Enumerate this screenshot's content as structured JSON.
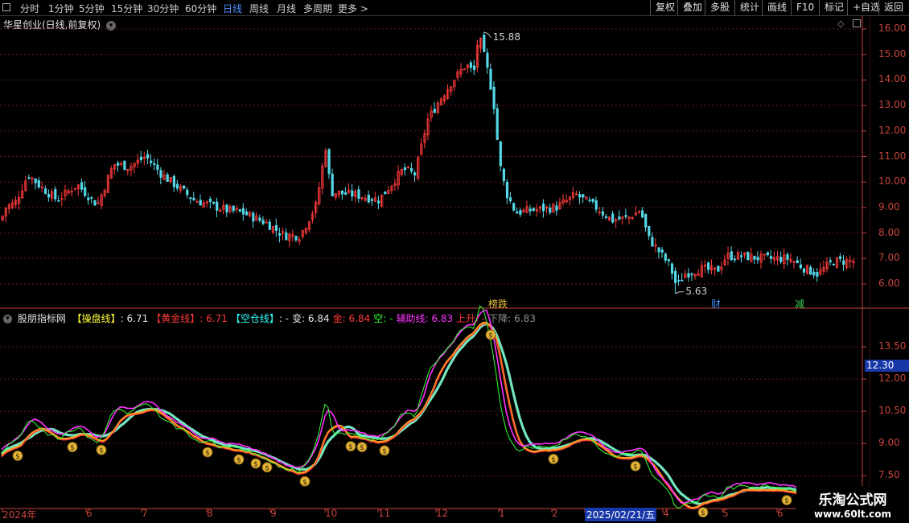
{
  "toolbar": {
    "periods": [
      "分时",
      "1分钟",
      "5分钟",
      "15分钟",
      "30分钟",
      "60分钟",
      "日线",
      "周线",
      "月线",
      "多周期",
      "更多 >"
    ],
    "active_period": "日线",
    "right_buttons": [
      "复权",
      "叠加",
      "多股",
      "统计",
      "画线",
      "F10",
      "标记",
      "+自选",
      "返回"
    ]
  },
  "main_panel": {
    "title": "华星创业(日线,前复权)",
    "y_ticks": [
      "16.00",
      "15.00",
      "14.00",
      "13.00",
      "12.00",
      "11.00",
      "10.00",
      "9.00",
      "8.00",
      "7.00",
      "6.00"
    ],
    "high_label": "15.88",
    "low_label": "5.63",
    "tags": [
      {
        "text": "榜跌",
        "color": "#e8c23a"
      },
      {
        "text": "财",
        "color": "#3a8cff"
      },
      {
        "text": "减",
        "color": "#32d052"
      }
    ]
  },
  "indicator_panel": {
    "name": "股朋指标网",
    "segments": [
      {
        "label": "【操盘线】",
        "value": ": 6.71",
        "label_color": "#ffff33",
        "value_color": "#e6e6e6"
      },
      {
        "label": "【黄金线】",
        "value": ": 6.71",
        "label_color": "#ff3a3a",
        "value_color": "#ff3a3a"
      },
      {
        "label": "【空仓线】",
        "value": ": -",
        "label_color": "#33ffff",
        "value_color": "#e6e6e6"
      },
      {
        "label": "变",
        "value": ": 6.84",
        "label_color": "#e6e6e6",
        "value_color": "#e6e6e6"
      },
      {
        "label": "金",
        "value": ": 6.84",
        "label_color": "#ff3a3a",
        "value_color": "#ff3a3a"
      },
      {
        "label": "空",
        "value": ": -",
        "label_color": "#33ff33",
        "value_color": "#33ff33"
      },
      {
        "label": "辅助线",
        "value": ": 6.83",
        "label_color": "#ff33ff",
        "value_color": "#ff33ff"
      },
      {
        "label": "上升",
        "value": ": -",
        "label_color": "#ff3a3a",
        "value_color": "#ff3a3a"
      },
      {
        "label": "下降",
        "value": ": 6.83",
        "label_color": "#909090",
        "value_color": "#909090"
      }
    ],
    "y_ticks": [
      "13.50",
      "12.00",
      "10.50",
      "9.00",
      "7.50"
    ],
    "current_value": "12.30"
  },
  "x_axis": {
    "labels": [
      "2024年",
      "6",
      "7",
      "8",
      "9",
      "10",
      "11",
      "12",
      "1",
      "2",
      "2025/02/21/五",
      "4",
      "5",
      "6"
    ]
  },
  "watermark": {
    "line1": "乐淘公式网",
    "line2": "www.60lt.com"
  },
  "colors": {
    "up": "#ff3b3b",
    "down": "#54d8e8",
    "axis": "#c8443d",
    "grid": "#6a1a1a",
    "operate": "#ffff33",
    "gold": "#ff3a3a",
    "empty": "#33ffff",
    "aux": "#ff33ff",
    "aux_green": "#33ff33"
  },
  "chart_data": {
    "type": "candlestick",
    "price_high": 15.88,
    "price_low": 5.63,
    "ylim_main": [
      5.4,
      16.4
    ],
    "ylim_indicator": [
      6.5,
      14.3
    ]
  }
}
